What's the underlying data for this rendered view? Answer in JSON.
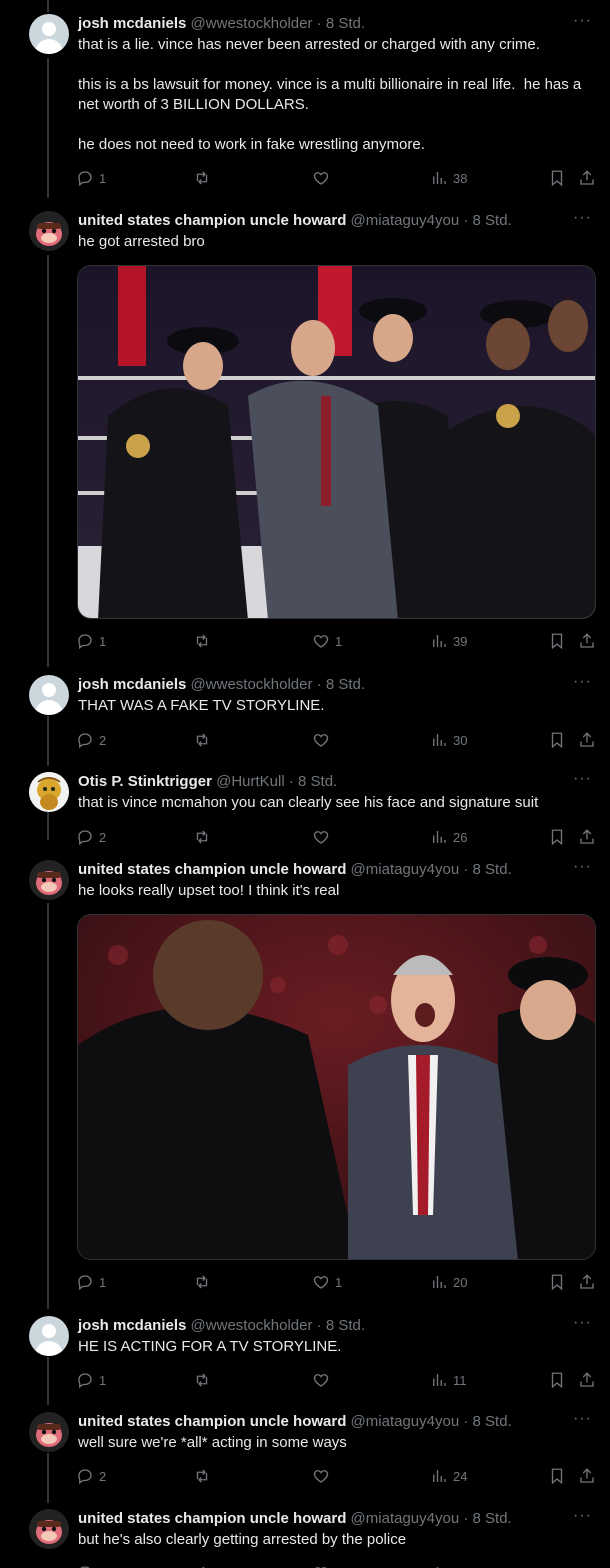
{
  "tweets": [
    {
      "name": "josh mcdaniels",
      "handle": "@wwestockholder",
      "time": "8 Std.",
      "text": "that is a lie. vince has never been arrested or charged with any crime.\n\nthis is a bs lawsuit for money. vince is a multi billionaire in real life.  he has a net worth of 3 BILLION DOLLARS.\n\nhe does not need to work in fake wrestling anymore.",
      "replies": "1",
      "reposts": "",
      "likes": "",
      "views": "38"
    },
    {
      "name": "united states champion uncle howard",
      "handle": "@miataguy4you",
      "time": "8 Std.",
      "text": "he got arrested bro",
      "replies": "1",
      "reposts": "",
      "likes": "1",
      "views": "39"
    },
    {
      "name": "josh mcdaniels",
      "handle": "@wwestockholder",
      "time": "8 Std.",
      "text": "THAT WAS A FAKE TV STORYLINE.",
      "replies": "2",
      "reposts": "",
      "likes": "",
      "views": "30"
    },
    {
      "name": "Otis P. Stinktrigger",
      "handle": "@HurtKull",
      "time": "8 Std.",
      "text": "that is vince mcmahon you can clearly see his face and signature suit",
      "replies": "2",
      "reposts": "",
      "likes": "",
      "views": "26"
    },
    {
      "name": "united states champion uncle howard",
      "handle": "@miataguy4you",
      "time": "8 Std.",
      "text": "he looks really upset too! I think it's real",
      "replies": "1",
      "reposts": "",
      "likes": "1",
      "views": "20"
    },
    {
      "name": "josh mcdaniels",
      "handle": "@wwestockholder",
      "time": "8 Std.",
      "text": "HE IS ACTING FOR A TV STORYLINE.",
      "replies": "1",
      "reposts": "",
      "likes": "",
      "views": "11"
    },
    {
      "name": "united states champion uncle howard",
      "handle": "@miataguy4you",
      "time": "8 Std.",
      "text": "well sure we're *all* acting in some ways",
      "replies": "2",
      "reposts": "",
      "likes": "",
      "views": "24"
    },
    {
      "name": "united states champion uncle howard",
      "handle": "@miataguy4you",
      "time": "8 Std.",
      "text": "but he's also clearly getting arrested by the police",
      "replies": "",
      "reposts": "",
      "likes": "",
      "views": ""
    }
  ],
  "ui": {
    "dot": "·",
    "more": "···"
  },
  "icons": [
    "reply-icon",
    "repost-icon",
    "like-icon",
    "views-icon",
    "bookmark-icon",
    "share-icon",
    "more-icon"
  ],
  "colors": {
    "background": "#000000",
    "text": "#e7e9ea",
    "muted": "#71767b",
    "divider": "#333639"
  }
}
